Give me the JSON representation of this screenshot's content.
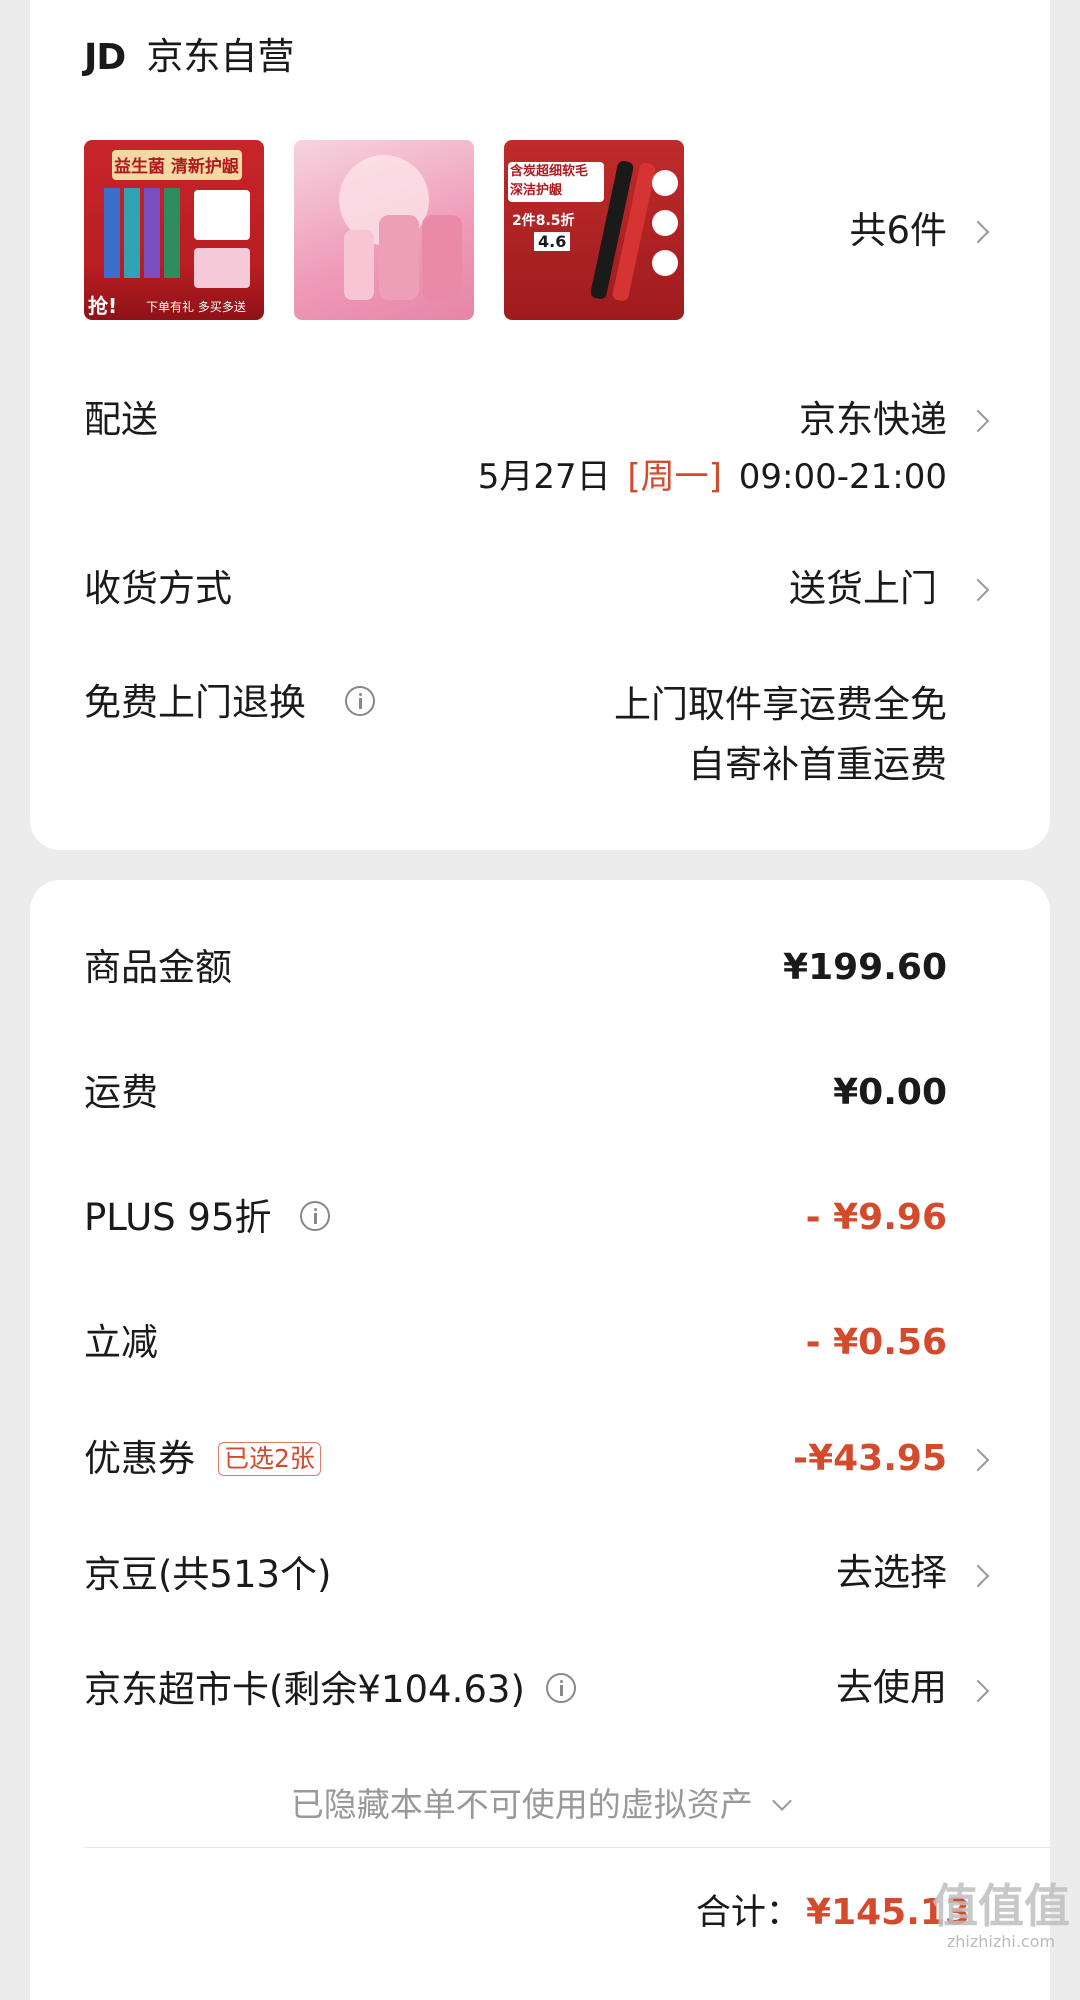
{
  "store": {
    "logo": "JD",
    "name": "京东自营"
  },
  "products": {
    "count_label": "共6件",
    "thumbnails": [
      {
        "alt": "toothpaste-product",
        "headline": "益生菌 清新护龈",
        "tag": "抢!",
        "footer": "下单有礼 多买多送"
      },
      {
        "alt": "body-care-gift-set",
        "headline": ""
      },
      {
        "alt": "toothbrush-product",
        "headline": "含炭超细软毛 深洁护龈",
        "promo": "2件8.5折",
        "price": "4.6"
      }
    ]
  },
  "delivery": {
    "label": "配送",
    "carrier": "京东快递",
    "date": "5月27日",
    "weekday": "[周一]",
    "time": "09:00-21:00"
  },
  "receive": {
    "label": "收货方式",
    "value": "送货上门"
  },
  "returns": {
    "label": "免费上门退换",
    "line1": "上门取件享运费全免",
    "line2": "自寄补首重运费"
  },
  "summary": {
    "goods_amount": {
      "label": "商品金额",
      "value": "¥199.60"
    },
    "shipping": {
      "label": "运费",
      "value": "¥0.00"
    },
    "plus": {
      "label": "PLUS 95折",
      "value": "- ¥9.96"
    },
    "instant": {
      "label": "立减",
      "value": "- ¥0.56"
    },
    "coupon": {
      "label": "优惠券",
      "badge": "已选2张",
      "value": "-¥43.95"
    },
    "jingdou": {
      "label": "京豆(共513个)",
      "value": "去选择"
    },
    "card": {
      "label": "京东超市卡(剩余¥104.63)",
      "value": "去使用"
    },
    "hidden_assets": "已隐藏本单不可使用的虚拟资产",
    "total_label": "合计：",
    "total_value": "¥145.13"
  },
  "watermark": {
    "text": "值值值",
    "url": "zhizhizhi.com"
  },
  "colors": {
    "accent": "#d34a2c",
    "background": "#ececec",
    "card": "#ffffff"
  }
}
